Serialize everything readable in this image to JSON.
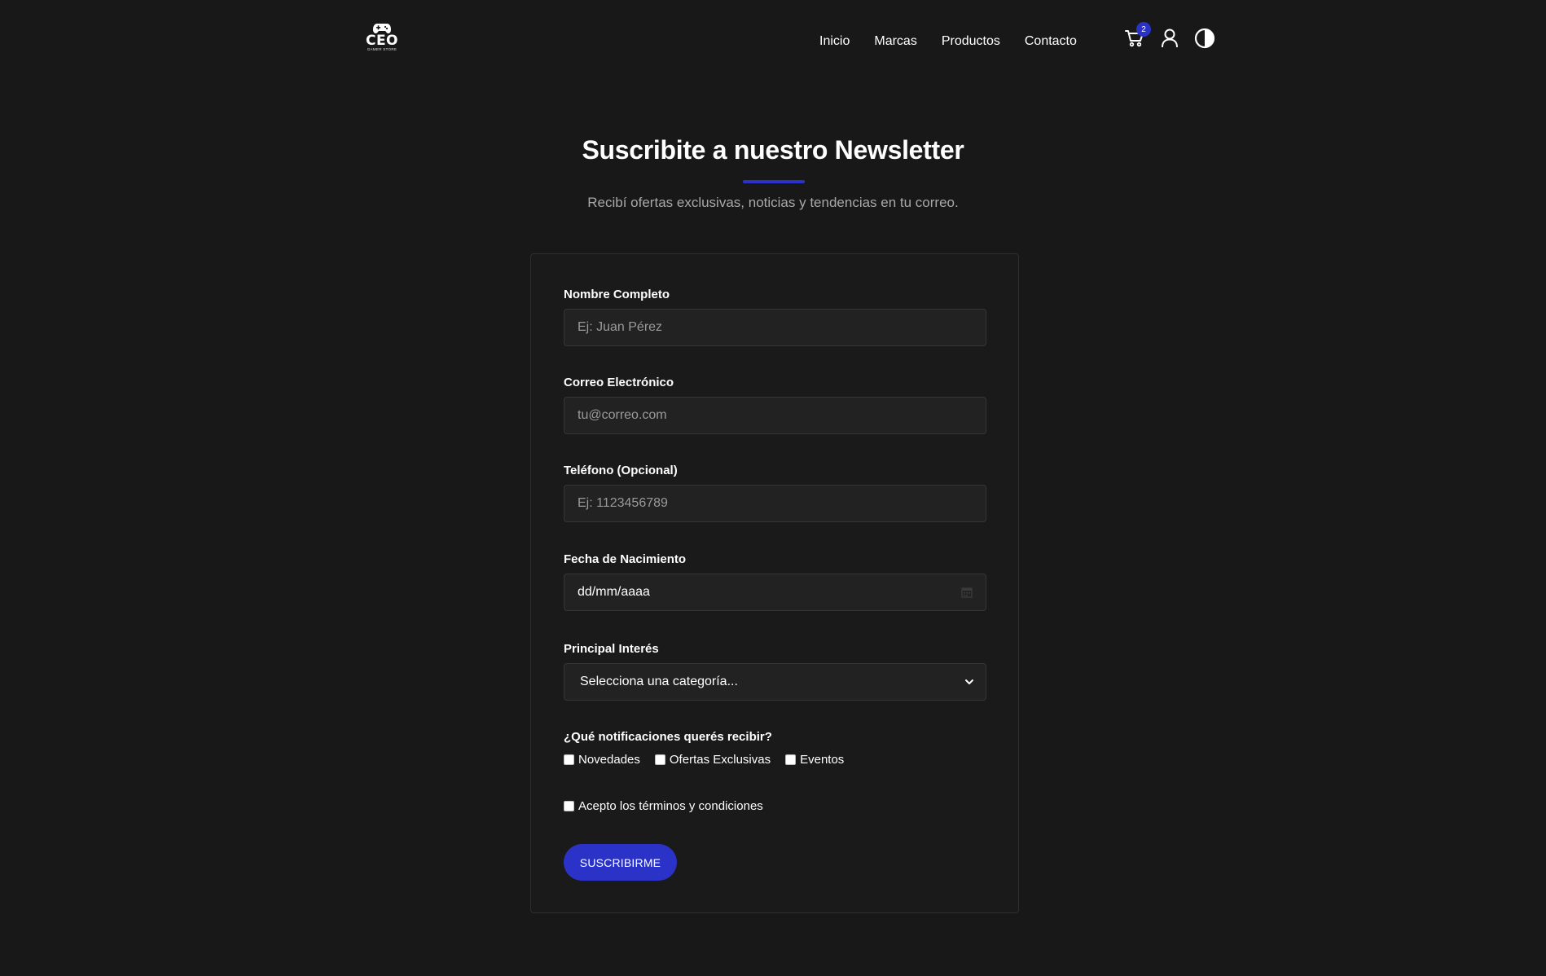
{
  "header": {
    "logo": {
      "main": "CEO",
      "sub": "GAMER STORE"
    },
    "nav": [
      {
        "label": "Inicio"
      },
      {
        "label": "Marcas"
      },
      {
        "label": "Productos"
      },
      {
        "label": "Contacto"
      }
    ],
    "cart_count": "2",
    "icons": [
      "cart-icon",
      "user-icon",
      "theme-toggle-icon"
    ]
  },
  "page": {
    "title": "Suscribite a nuestro Newsletter",
    "subtitle": "Recibí ofertas exclusivas, noticias y tendencias en tu correo."
  },
  "form": {
    "name": {
      "label": "Nombre Completo",
      "placeholder": "Ej: Juan Pérez"
    },
    "email": {
      "label": "Correo Electrónico",
      "placeholder": "tu@correo.com"
    },
    "phone": {
      "label": "Teléfono (Opcional)",
      "placeholder": "Ej: 1123456789"
    },
    "birthdate": {
      "label": "Fecha de Nacimiento",
      "value": "dd/mm/aaaa"
    },
    "interest": {
      "label": "Principal Interés",
      "selected": "Selecciona una categoría..."
    },
    "notifications": {
      "label": "¿Qué notificaciones querés recibir?",
      "options": [
        "Novedades",
        "Ofertas Exclusivas",
        "Eventos"
      ]
    },
    "terms": "Acepto los términos y condiciones",
    "submit": "SUSCRIBIRME"
  },
  "colors": {
    "background": "#181818",
    "accent": "#2b32c8",
    "text": "#ffffff",
    "muted": "#a8a8a8"
  }
}
